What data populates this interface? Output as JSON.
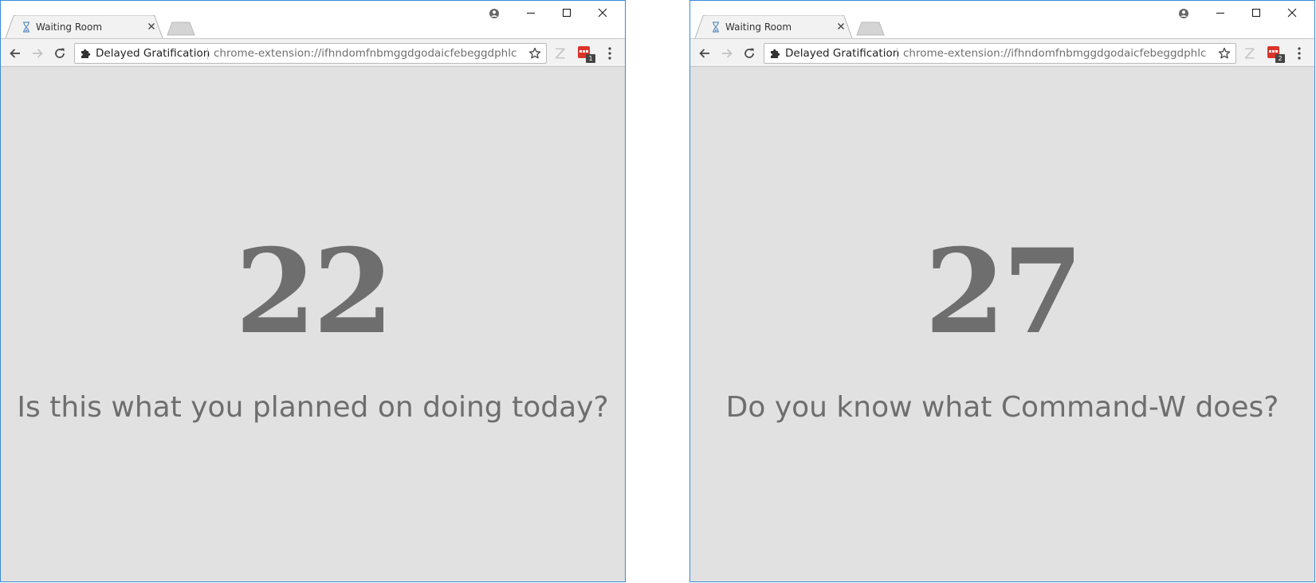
{
  "windows": [
    {
      "tab": {
        "title": "Waiting Room",
        "icon": "hourglass-icon"
      },
      "address_bar": {
        "site_name": "Delayed Gratification",
        "url": "chrome-extension://ifhndomfnbmggdgodaicfebeggdphlcn/..."
      },
      "extensions": {
        "badge": "1"
      },
      "countdown": "22",
      "message": "Is this what you planned on doing today?"
    },
    {
      "tab": {
        "title": "Waiting Room",
        "icon": "hourglass-icon"
      },
      "address_bar": {
        "site_name": "Delayed Gratification",
        "url": "chrome-extension://ifhndomfnbmggdgodaicfebeggdphlcn/..."
      },
      "extensions": {
        "badge": "2"
      },
      "countdown": "27",
      "message": "Do you know what Command-W does?"
    }
  ],
  "colors": {
    "page_background": "#e1e1e1",
    "text": "#6e6e6e",
    "window_border": "#3b8ad9",
    "extension_red": "#d9352b"
  }
}
